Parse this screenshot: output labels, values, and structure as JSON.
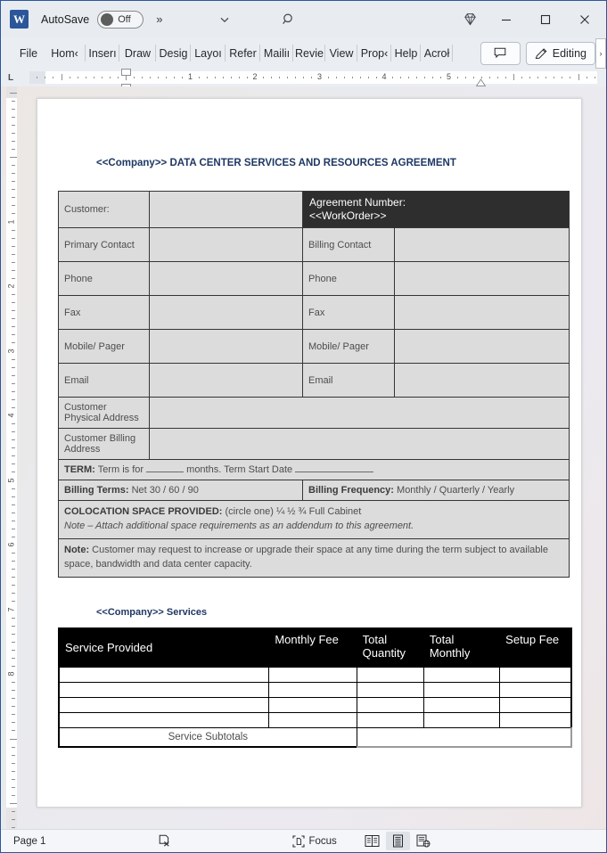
{
  "app": {
    "logo_text": "W",
    "autosave_label": "AutoSave",
    "autosave_state": "Off",
    "more_chevron": "»",
    "quick_chevron_icon": "chevron-down-icon",
    "search_icon": "search-icon",
    "premium_icon": "diamond-icon",
    "minimize_icon": "minimize-icon",
    "maximize_icon": "maximize-icon",
    "close_icon": "close-icon",
    "accent_color": "#2b579a"
  },
  "ribbon": {
    "tabs": [
      "File",
      "Hom‹",
      "Inserı",
      "Draw",
      "Desiɡ",
      "Layoı",
      "Refer",
      "Mailiı",
      "Revie",
      "View",
      "Prop‹",
      "Help",
      "Acroł"
    ],
    "comments_label": "",
    "comments_icon": "comment-icon",
    "editing_label": "Editing",
    "editing_icon": "pencil-icon",
    "expand_label": "›"
  },
  "ruler": {
    "corner_label": "L",
    "h_numbers": [
      "1",
      "2",
      "3",
      "4",
      "5"
    ],
    "v_numbers": [
      "1",
      "2",
      "3",
      "4",
      "5",
      "6",
      "7",
      "8"
    ]
  },
  "document": {
    "title": "<<Company>> DATA CENTER SERVICES AND RESOURCES AGREEMENT",
    "services_heading": "<<Company>> Services",
    "info_table": {
      "customer_label": "Customer:",
      "customer_value": "",
      "agreement_number_label": "Agreement Number:",
      "agreement_number_value": "<<WorkOrder>>",
      "rows": [
        {
          "left_label": "Primary Contact",
          "left_value": "",
          "right_label": "Billing Contact",
          "right_value": ""
        },
        {
          "left_label": "Phone",
          "left_value": "",
          "right_label": "Phone",
          "right_value": ""
        },
        {
          "left_label": "Fax",
          "left_value": "",
          "right_label": "Fax",
          "right_value": ""
        },
        {
          "left_label": "Mobile/ Pager",
          "left_value": "",
          "right_label": "Mobile/ Pager",
          "right_value": ""
        },
        {
          "left_label": "Email",
          "left_value": "",
          "right_label": "Email",
          "right_value": ""
        }
      ],
      "physical_address_label": "Customer Physical Address",
      "physical_address_value": "",
      "billing_address_label": "Customer Billing Address",
      "billing_address_value": "",
      "term_label": "TERM:",
      "term_text_1": "Term is for",
      "term_text_2": "months.  Term Start Date",
      "billing_terms_label": "Billing Terms:",
      "billing_terms_value": "Net 30 / 60 / 90",
      "billing_frequency_label": "Billing Frequency:",
      "billing_frequency_value": "Monthly /  Quarterly /  Yearly",
      "colocation_label": "COLOCATION SPACE PROVIDED:",
      "colocation_value": "(circle one) ¼   ½   ¾  Full  Cabinet",
      "colocation_note": "Note – Attach additional space requirements as an addendum to this agreement.",
      "note_label": "Note:",
      "note_text": "Customer may request to increase or upgrade their space at any time during the term subject to available space, bandwidth and data center capacity."
    },
    "services_table": {
      "headers": [
        "Service Provided",
        "Monthly Fee",
        "Total Quantity",
        "Total Monthly",
        "Setup Fee"
      ],
      "rows": [
        [
          "",
          "",
          "",
          "",
          ""
        ],
        [
          "",
          "",
          "",
          "",
          ""
        ],
        [
          "",
          "",
          "",
          "",
          ""
        ],
        [
          "",
          "",
          "",
          "",
          ""
        ]
      ],
      "subtotal_label": "Service Subtotals",
      "subtotal_value": ""
    }
  },
  "statusbar": {
    "page_label": "Page 1",
    "proofing_icon": "proofing-errors-icon",
    "focus_label": "Focus",
    "focus_icon": "focus-icon",
    "view_read_icon": "read-mode-icon",
    "view_print_icon": "print-layout-icon",
    "view_web_icon": "web-layout-icon"
  }
}
